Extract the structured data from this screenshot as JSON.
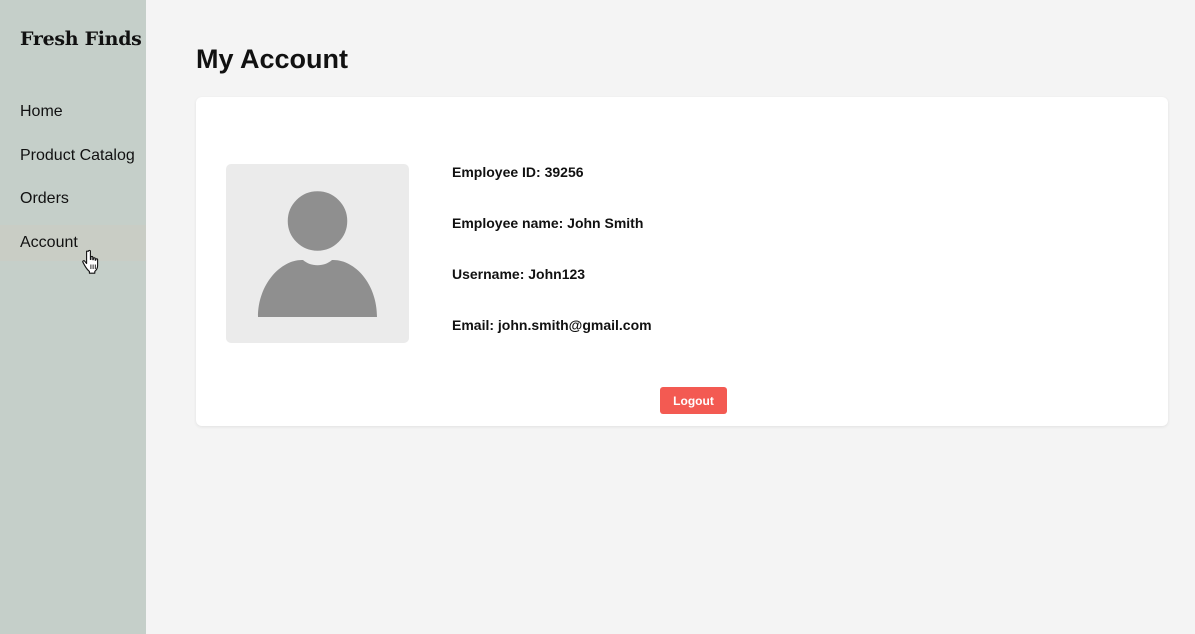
{
  "sidebar": {
    "brand": "Fresh Finds",
    "items": [
      {
        "label": "Home"
      },
      {
        "label": "Product Catalog"
      },
      {
        "label": "Orders"
      },
      {
        "label": "Account"
      }
    ],
    "active_item": "Account",
    "cursor_icon": "hand-pointer-icon"
  },
  "main": {
    "title": "My Account",
    "profile": {
      "avatar_icon": "user-avatar-icon",
      "employee_id": "Employee ID: 39256",
      "employee_name": "Employee name: John Smith",
      "username": "Username: John123",
      "email": "Email: john.smith@gmail.com"
    },
    "logout_label": "Logout"
  },
  "colors": {
    "sidebar_bg": "#c5cfc9",
    "page_bg": "#f4f4f4",
    "card_bg": "#ffffff",
    "avatar_bg": "#ebebeb",
    "avatar_fg": "#8f8f8f",
    "logout_bg": "#f35a52"
  }
}
